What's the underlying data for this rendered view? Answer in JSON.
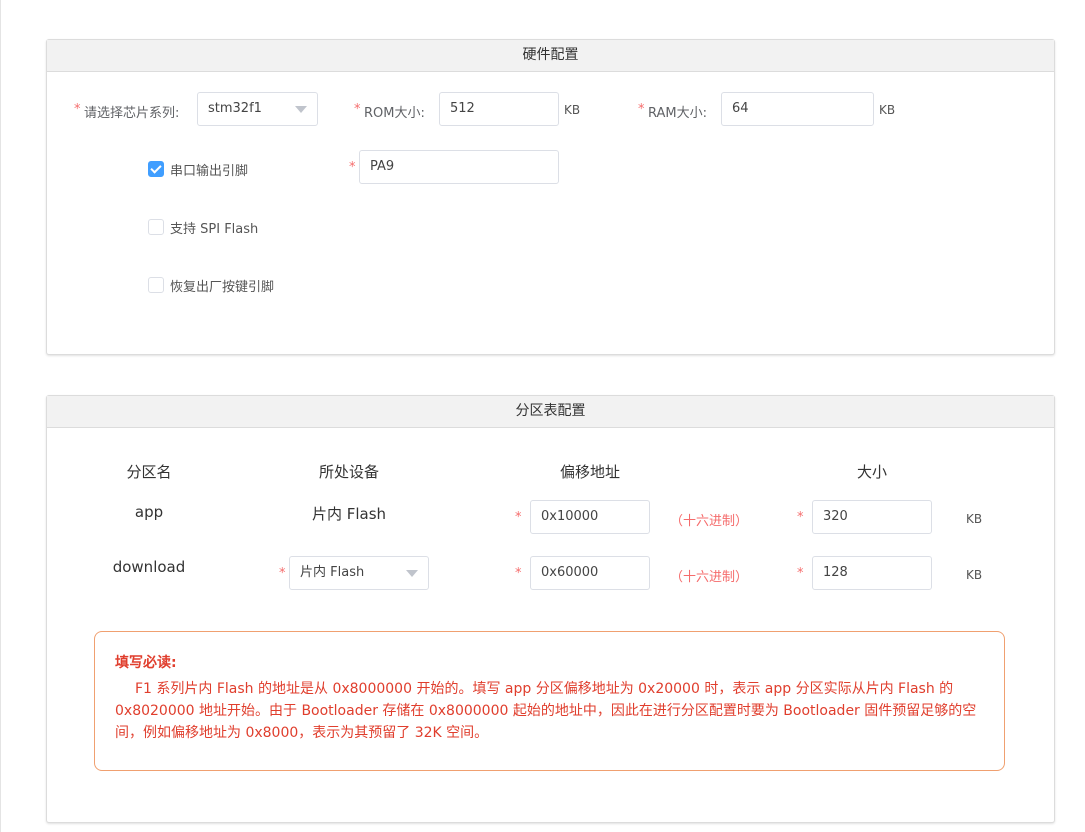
{
  "hardware": {
    "title": "硬件配置",
    "chip_label": "请选择芯片系列:",
    "chip_value": "stm32f1",
    "rom_label": "ROM大小:",
    "rom_value": "512",
    "rom_unit": "KB",
    "ram_label": "RAM大小:",
    "ram_value": "64",
    "ram_unit": "KB",
    "uart_label": "串口输出引脚",
    "uart_checked": true,
    "uart_pin_value": "PA9",
    "spi_label": "支持 SPI Flash",
    "spi_checked": false,
    "reset_label": "恢复出厂按键引脚",
    "reset_checked": false,
    "required_mark": "*"
  },
  "partition": {
    "title": "分区表配置",
    "headers": [
      "分区名",
      "所处设备",
      "偏移地址",
      "大小"
    ],
    "rows": [
      {
        "name": "app",
        "device": "片内 Flash",
        "offset": "0x10000",
        "hex_note": "（十六进制）",
        "size": "320",
        "unit": "KB"
      },
      {
        "name": "download",
        "device": "片内 Flash",
        "offset": "0x60000",
        "hex_note": "（十六进制）",
        "size": "128",
        "unit": "KB"
      }
    ]
  },
  "notice": {
    "title": "填写必读:",
    "body": "F1 系列片内 Flash 的地址是从 0x8000000 开始的。填写 app 分区偏移地址为 0x20000 时，表示 app 分区实际从片内 Flash 的 0x8020000 地址开始。由于 Bootloader 存储在 0x8000000 起始的地址中，因此在进行分区配置时要为 Bootloader 固件预留足够的空间，例如偏移地址为 0x8000，表示为其预留了 32K 空间。"
  },
  "colors": {
    "required": "#f56c6c",
    "checkbox_checked": "#409eff",
    "notice_border": "#f0a070",
    "notice_text": "#e03e2d"
  }
}
